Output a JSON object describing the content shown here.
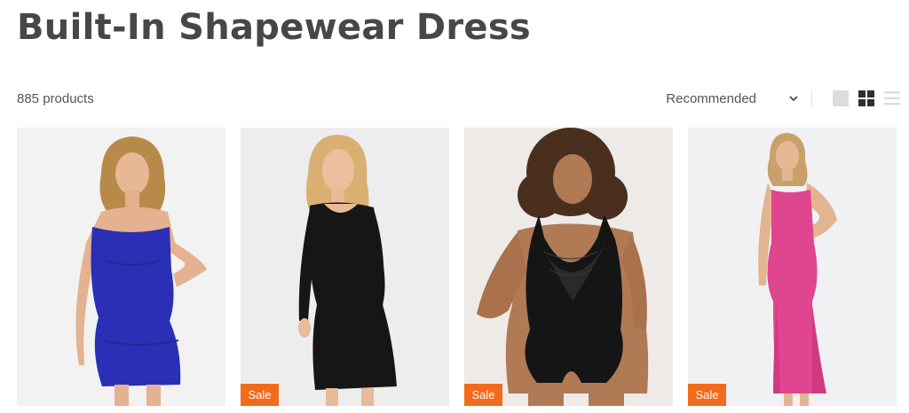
{
  "page": {
    "title": "Built-In Shapewear Dress"
  },
  "toolbar": {
    "product_count": "885 products",
    "sort": {
      "selected": "Recommended",
      "icon": "chevron-down-icon"
    },
    "view_modes": [
      {
        "name": "single-column-view-icon",
        "active": false
      },
      {
        "name": "grid-view-icon",
        "active": true
      },
      {
        "name": "list-view-icon",
        "active": false
      }
    ]
  },
  "products": [
    {
      "color": "#2a2fb5",
      "style": "blue spaghetti-strap mini dress",
      "badge": ""
    },
    {
      "color": "#161616",
      "style": "black long-sleeve midi dress",
      "badge": "Sale"
    },
    {
      "color": "#151515",
      "style": "black lace bodysuit",
      "badge": "Sale"
    },
    {
      "color": "#e0458f",
      "style": "pink maxi slip dress",
      "badge": "Sale"
    }
  ],
  "colors": {
    "sale_badge": "#f26a1b",
    "title": "#474747",
    "muted_text": "#555555"
  }
}
